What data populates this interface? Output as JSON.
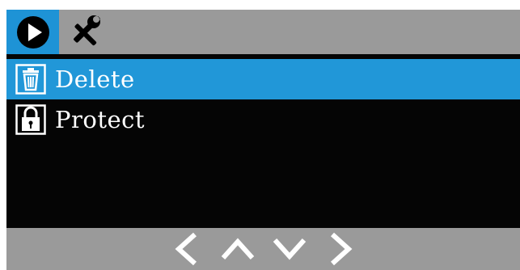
{
  "tabs": [
    {
      "id": "playback",
      "icon": "play-icon",
      "active": true
    },
    {
      "id": "setup",
      "icon": "tools-icon",
      "active": false
    }
  ],
  "menu": {
    "items": [
      {
        "label": "Delete",
        "icon": "trash-icon",
        "selected": true
      },
      {
        "label": "Protect",
        "icon": "lock-icon",
        "selected": false
      }
    ]
  },
  "nav": {
    "buttons": [
      {
        "icon": "chevron-left-icon"
      },
      {
        "icon": "chevron-up-icon"
      },
      {
        "icon": "chevron-down-icon"
      },
      {
        "icon": "chevron-right-icon"
      }
    ]
  },
  "colors": {
    "accent": "#2197d8",
    "bar": "#9a9a9a",
    "background": "#050505",
    "text": "#ffffff"
  }
}
